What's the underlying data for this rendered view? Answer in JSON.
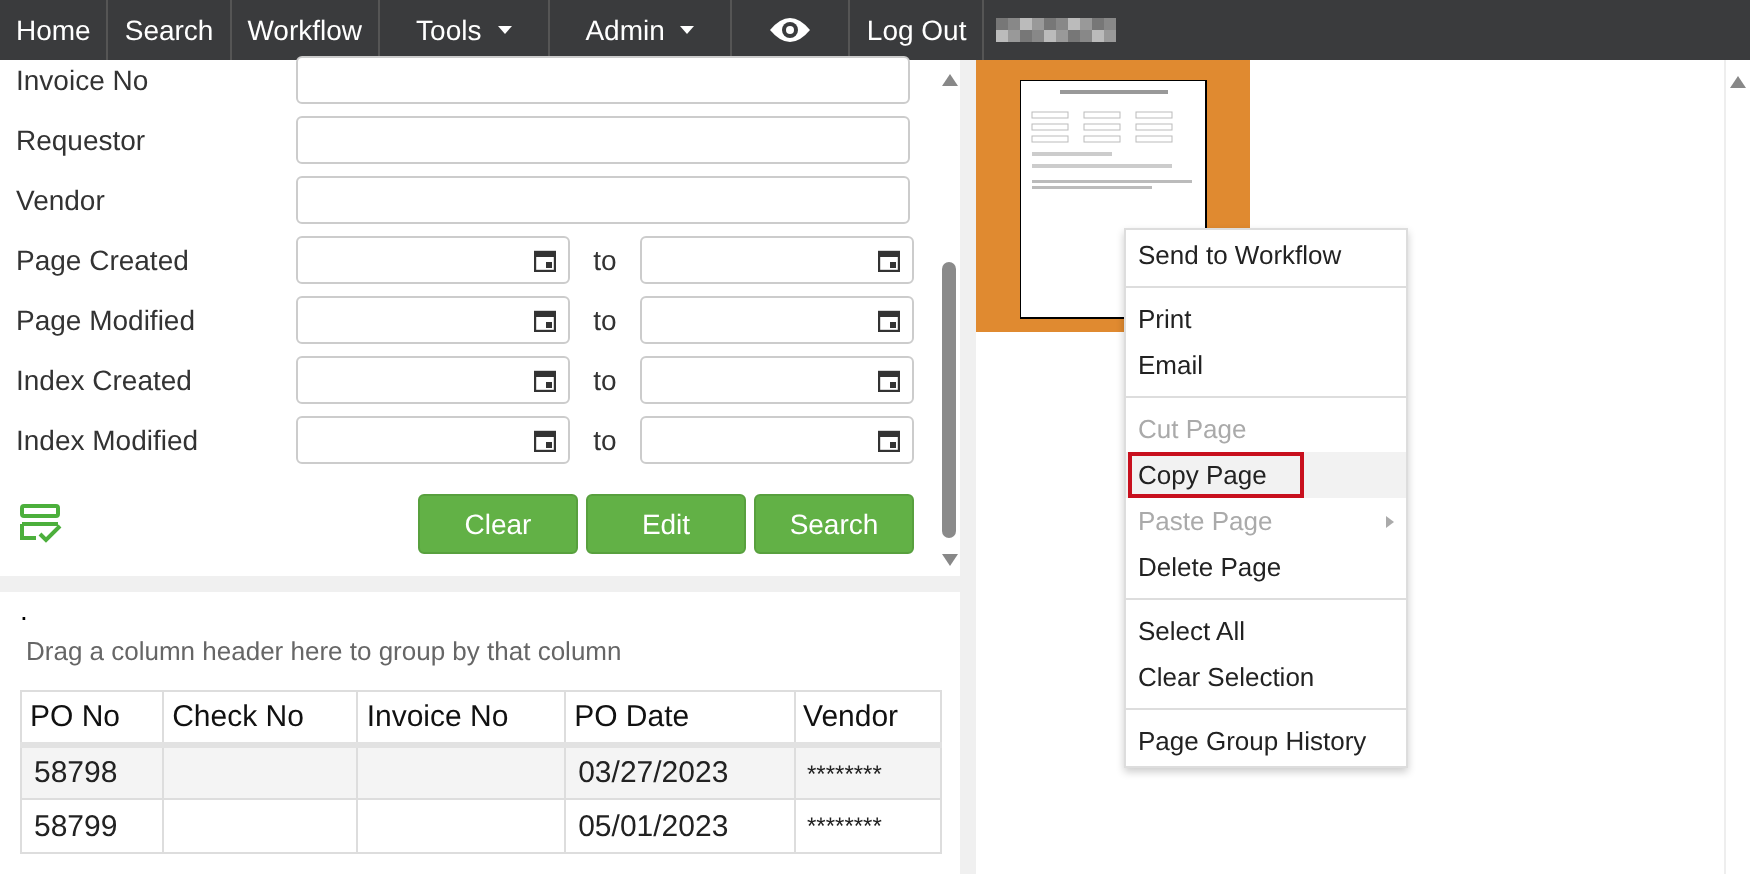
{
  "nav": {
    "items": [
      {
        "label": "Home",
        "dropdown": false
      },
      {
        "label": "Search",
        "dropdown": false
      },
      {
        "label": "Workflow",
        "dropdown": false
      },
      {
        "label": "Tools",
        "dropdown": true
      },
      {
        "label": "Admin",
        "dropdown": true
      },
      {
        "kind": "eye"
      },
      {
        "label": "Log Out",
        "dropdown": false
      }
    ]
  },
  "search_form": {
    "fields": [
      {
        "kind": "text",
        "label": "Invoice No"
      },
      {
        "kind": "text",
        "label": "Requestor"
      },
      {
        "kind": "text",
        "label": "Vendor"
      },
      {
        "kind": "range",
        "label": "Page Created",
        "separator": "to"
      },
      {
        "kind": "range",
        "label": "Page Modified",
        "separator": "to"
      },
      {
        "kind": "range",
        "label": "Index Created",
        "separator": "to"
      },
      {
        "kind": "range",
        "label": "Index Modified",
        "separator": "to"
      }
    ],
    "buttons": [
      "Clear",
      "Edit",
      "Search"
    ]
  },
  "results": {
    "marker": ".",
    "group_hint": "Drag a column header here to group by that column",
    "columns": [
      "PO No",
      "Check No",
      "Invoice No",
      "PO Date",
      "Vendor"
    ],
    "rows": [
      [
        "58798",
        "",
        "",
        "03/27/2023",
        "********"
      ],
      [
        "58799",
        "",
        "",
        "05/01/2023",
        "********"
      ]
    ]
  },
  "context_menu": {
    "groups": [
      [
        {
          "label": "Send to Workflow",
          "disabled": false,
          "selected": false,
          "submenu": false
        }
      ],
      [
        {
          "label": "Print",
          "disabled": false,
          "selected": false,
          "submenu": false
        },
        {
          "label": "Email",
          "disabled": false,
          "selected": false,
          "submenu": false
        }
      ],
      [
        {
          "label": "Cut Page",
          "disabled": true,
          "selected": false,
          "submenu": false
        },
        {
          "label": "Copy Page",
          "disabled": false,
          "selected": true,
          "submenu": false
        },
        {
          "label": "Paste Page",
          "disabled": true,
          "selected": false,
          "submenu": true
        },
        {
          "label": "Delete Page",
          "disabled": false,
          "selected": false,
          "submenu": false
        }
      ],
      [
        {
          "label": "Select All",
          "disabled": false,
          "selected": false,
          "submenu": false
        },
        {
          "label": "Clear Selection",
          "disabled": false,
          "selected": false,
          "submenu": false
        }
      ],
      [
        {
          "label": "Page Group History",
          "disabled": false,
          "selected": false,
          "submenu": false
        }
      ]
    ]
  }
}
